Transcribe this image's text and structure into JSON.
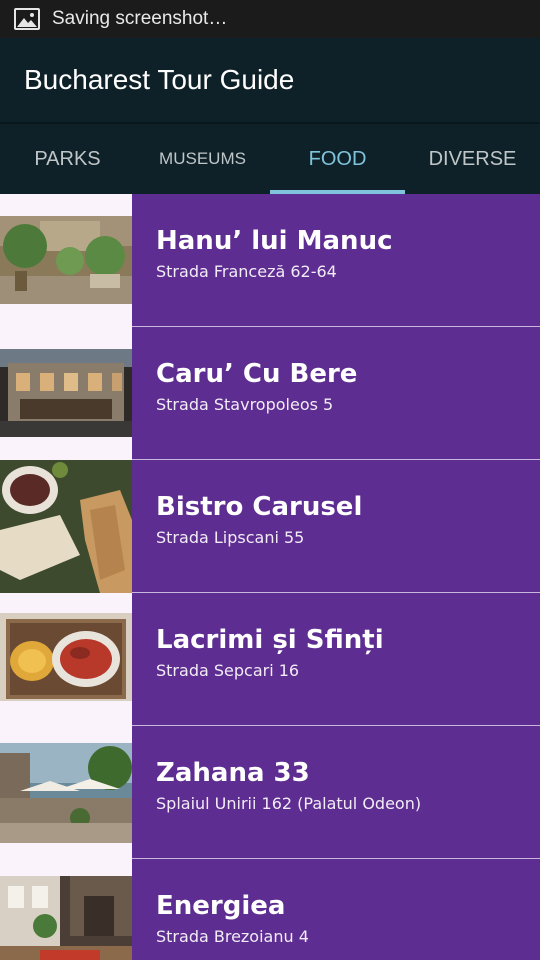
{
  "status_bar": {
    "icon": "image-icon",
    "text": "Saving screenshot…"
  },
  "action_bar": {
    "title": "Bucharest Tour Guide"
  },
  "tabs": [
    {
      "label": "PARKS",
      "active": false
    },
    {
      "label": "MUSEUMS",
      "active": false
    },
    {
      "label": "FOOD",
      "active": true
    },
    {
      "label": "DIVERSE",
      "active": false
    }
  ],
  "places": [
    {
      "name": "Hanu’ lui Manuc",
      "address": "Strada Franceză 62-64"
    },
    {
      "name": "Caru’ Cu Bere",
      "address": "Strada Stavropoleos 5"
    },
    {
      "name": "Bistro Carusel",
      "address": "Strada Lipscani 55"
    },
    {
      "name": "Lacrimi și Sfinți",
      "address": "Strada Sepcari 16"
    },
    {
      "name": "Zahana 33",
      "address": "Splaiul Unirii 162 (Palatul Odeon)"
    },
    {
      "name": "Energiea",
      "address": "Strada Brezoianu 4"
    }
  ],
  "colors": {
    "action_bar": "#0f2128",
    "accent": "#7fc4dc",
    "item_background": "#5e2d91"
  }
}
